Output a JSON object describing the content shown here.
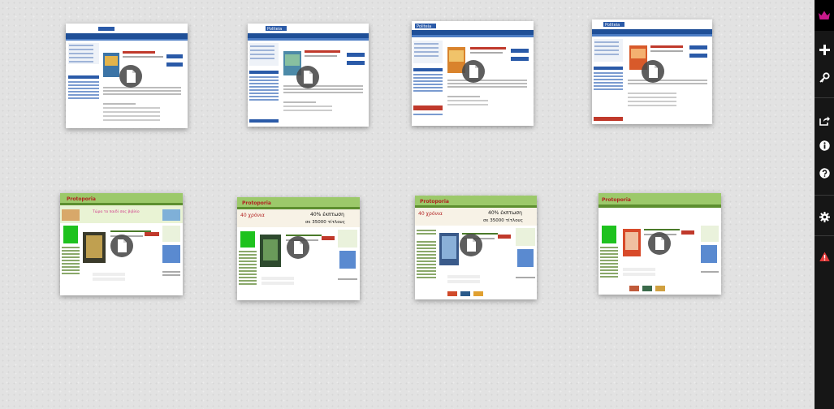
{
  "toolbar": {
    "items": [
      {
        "name": "app-logo",
        "icon": "crown-logo-icon",
        "color": "#c8198c"
      },
      {
        "name": "add",
        "icon": "plus-icon",
        "color": "#ffffff"
      },
      {
        "name": "key",
        "icon": "key-icon",
        "color": "#ffffff"
      },
      {
        "name": "share",
        "icon": "share-icon",
        "color": "#ffffff"
      },
      {
        "name": "info",
        "icon": "info-icon",
        "color": "#ffffff"
      },
      {
        "name": "help",
        "icon": "help-icon",
        "color": "#ffffff"
      },
      {
        "name": "settings",
        "icon": "gear-icon",
        "color": "#ffffff"
      },
      {
        "name": "alert",
        "icon": "warning-icon",
        "color": "#e23a3a"
      }
    ]
  },
  "thumbnails": [
    {
      "site": "Politeia",
      "badge_icon": "document-icon",
      "theme_color": "#2a5aa8"
    },
    {
      "site": "Politeia",
      "badge_icon": "document-icon",
      "theme_color": "#2a5aa8"
    },
    {
      "site": "Politeia",
      "badge_icon": "document-icon",
      "theme_color": "#2a5aa8"
    },
    {
      "site": "Politeia",
      "badge_icon": "document-icon",
      "theme_color": "#2a5aa8"
    },
    {
      "site": "Protoporia",
      "badge_icon": "document-icon",
      "theme_color": "#7cb342",
      "banner": "Τώρα το παιδί σας βιβλίο"
    },
    {
      "site": "Protoporia",
      "badge_icon": "document-icon",
      "theme_color": "#7cb342",
      "banner_left": "40 χρόνια",
      "banner_right": "40% έκπτωση",
      "banner_sub": "σε 35000 τίτλους"
    },
    {
      "site": "Protoporia",
      "badge_icon": "document-icon",
      "theme_color": "#7cb342",
      "banner_left": "40 χρόνια",
      "banner_right": "40% έκπτωση",
      "banner_sub": "σε 35000 τίτλους"
    },
    {
      "site": "Protoporia",
      "badge_icon": "document-icon",
      "theme_color": "#7cb342"
    }
  ],
  "colors": {
    "background": "#e2e2e2",
    "toolbar_bg": "#161616",
    "badge_bg": "#484848"
  }
}
